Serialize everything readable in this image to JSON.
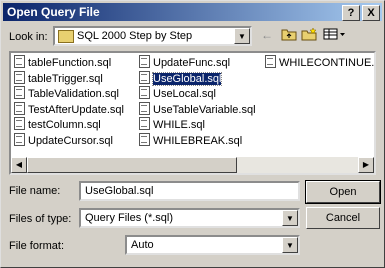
{
  "window": {
    "title": "Open Query File",
    "help_btn": "?",
    "close_btn": "X"
  },
  "lookin": {
    "label": "Look in:",
    "value": "SQL 2000 Step by Step"
  },
  "files": {
    "col1": [
      "tableFunction.sql",
      "tableTrigger.sql",
      "TableValidation.sql",
      "TestAfterUpdate.sql",
      "testColumn.sql",
      "UpdateCursor.sql"
    ],
    "col2": [
      "UpdateFunc.sql",
      "UseGlobal.sql",
      "UseLocal.sql",
      "UseTableVariable.sql",
      "WHILE.sql",
      "WHILEBREAK.sql"
    ],
    "col3": [
      "WHILECONTINUE.sql"
    ],
    "selected": "UseGlobal.sql"
  },
  "filename": {
    "label": "File name:",
    "value": "UseGlobal.sql"
  },
  "filetype": {
    "label": "Files of type:",
    "value": "Query Files (*.sql)"
  },
  "fileformat": {
    "label": "File format:",
    "value": "Auto"
  },
  "buttons": {
    "open": "Open",
    "cancel": "Cancel"
  }
}
